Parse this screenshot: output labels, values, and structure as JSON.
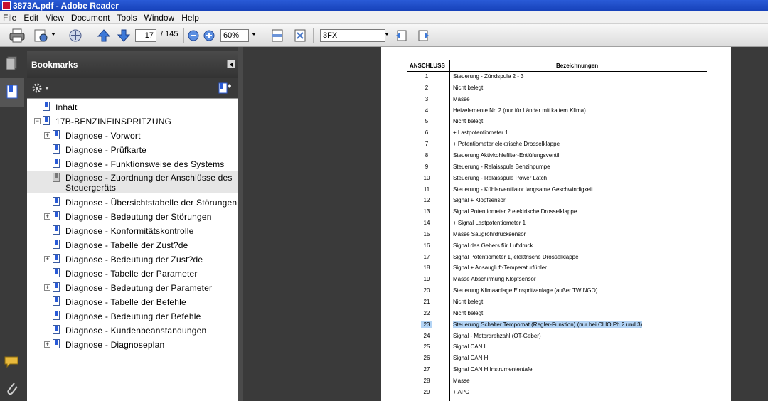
{
  "window": {
    "title": "3873A.pdf - Adobe Reader"
  },
  "menu": [
    "File",
    "Edit",
    "View",
    "Document",
    "Tools",
    "Window",
    "Help"
  ],
  "toolbar": {
    "page_current": "17",
    "page_total": "/ 145",
    "zoom": "60%",
    "search": "3FX"
  },
  "bookmarks": {
    "title": "Bookmarks",
    "items": [
      {
        "label": "Inhalt"
      },
      {
        "label": "17B-BENZINEINSPRITZUNG"
      },
      {
        "label": "Diagnose - Vorwort"
      },
      {
        "label": "Diagnose - Prüfkarte"
      },
      {
        "label": "Diagnose - Funktionsweise des Systems"
      },
      {
        "label": "Diagnose - Zuordnung der Anschlüsse des"
      },
      {
        "label": "Diagnose - Übersichtstabelle der Störungen"
      },
      {
        "label": "Diagnose - Bedeutung der Störungen"
      },
      {
        "label": "Diagnose - Konformitätskontrolle"
      },
      {
        "label": "Diagnose - Tabelle der Zust?de"
      },
      {
        "label": "Diagnose - Bedeutung der Zust?de"
      },
      {
        "label": "Diagnose - Tabelle der Parameter"
      },
      {
        "label": "Diagnose - Bedeutung der Parameter"
      },
      {
        "label": "Diagnose - Tabelle der Befehle"
      },
      {
        "label": "Diagnose - Bedeutung der Befehle"
      },
      {
        "label": "Diagnose - Kundenbeanstandungen"
      },
      {
        "label": "Diagnose - Diagnoseplan"
      }
    ],
    "item5_line2": "Steuergeräts"
  },
  "document": {
    "col_anschluss": "ANSCHLUSS",
    "col_bezeichnungen": "Bezeichnungen",
    "rows": [
      {
        "n": "1",
        "d": "Steuerung - Zündspule 2 - 3"
      },
      {
        "n": "2",
        "d": "Nicht belegt"
      },
      {
        "n": "3",
        "d": "Masse"
      },
      {
        "n": "4",
        "d": "Heizelemente Nr. 2 (nur für Länder mit kaltem Klima)"
      },
      {
        "n": "5",
        "d": "Nicht belegt"
      },
      {
        "n": "6",
        "d": "+ Lastpotentiometer 1"
      },
      {
        "n": "7",
        "d": "+ Potentiometer elektrische Drosselklappe"
      },
      {
        "n": "8",
        "d": "Steuerung Aktivkohlefilter-Entlüfungsventil"
      },
      {
        "n": "9",
        "d": "Steuerung - Relaisspule Benzinpumpe"
      },
      {
        "n": "10",
        "d": "Steuerung - Relaisspule Power Latch"
      },
      {
        "n": "11",
        "d": "Steuerung - Kühlerventilator langsame Geschwindigkeit"
      },
      {
        "n": "12",
        "d": "Signal + Klopfsensor"
      },
      {
        "n": "13",
        "d": "Signal Potentiometer 2 elektrische Drosselklappe"
      },
      {
        "n": "14",
        "d": "+ Signal Lastpotentiometer 1"
      },
      {
        "n": "15",
        "d": "Masse Saugrohrdrucksensor"
      },
      {
        "n": "16",
        "d": "Signal des Gebers für Luftdruck"
      },
      {
        "n": "17",
        "d": "Signal Potentiometer 1, elektrische Drosselklappe"
      },
      {
        "n": "18",
        "d": "Signal + Ansaugluft-Temperaturfühler"
      },
      {
        "n": "19",
        "d": "Masse Abschirmung Klopfsensor"
      },
      {
        "n": "20",
        "d": "Steuerung Klimaanlage Einspritzanlage (außer TWINGO)"
      },
      {
        "n": "21",
        "d": "Nicht belegt"
      },
      {
        "n": "22",
        "d": "Nicht belegt"
      },
      {
        "n": "23",
        "d": "Steuerung Schalter Tempomat (Regler-Funktion) (nur bei CLIO Ph 2 und 3)"
      },
      {
        "n": "24",
        "d": "Signal - Motordrehzahl (OT-Geber)"
      },
      {
        "n": "25",
        "d": "Signal CAN L"
      },
      {
        "n": "26",
        "d": "Signal CAN H"
      },
      {
        "n": "27",
        "d": "Signal CAN H Instrumententafel"
      },
      {
        "n": "28",
        "d": "Masse"
      },
      {
        "n": "29",
        "d": "+ APC"
      }
    ]
  },
  "icons": {
    "print": "printer-icon",
    "email": "email-icon",
    "collab": "collaborate-icon",
    "prev": "previous-page-icon",
    "next": "next-page-icon",
    "zoom_out": "zoom-out-icon",
    "zoom_in": "zoom-in-icon",
    "fit_width": "fit-width-icon",
    "fit_page": "fit-page-icon",
    "find_prev": "find-previous-icon",
    "find_next": "find-next-icon"
  },
  "colors": {
    "title_bar": "#1f4fcc",
    "highlight": "#b3d4f5",
    "panel": "#3a3a3a"
  }
}
